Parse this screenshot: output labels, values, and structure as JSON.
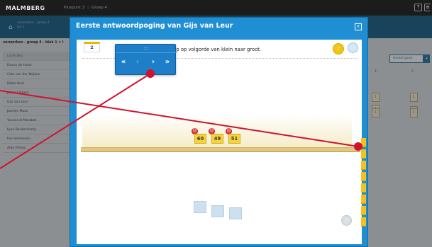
{
  "topbar": {
    "logo": "MALMBERG",
    "crumb_1": "Pluspunt 3",
    "crumb_2": "Groep 4",
    "help_icon": "?"
  },
  "background": {
    "header_title_1": "verwerken - groep 4",
    "header_title_2": "les 1",
    "filter_label": "verwerken - groep 4 - blok 1 > l",
    "students_header": "LEERLING",
    "students": [
      "Davey de Haan",
      "Cato van der Keijzen",
      "Robin Knol",
      "Justin Lamers",
      "Gijs van Leur",
      "Jasmijn Maas",
      "Younes el Morabet",
      "Lynn Beukenkamp",
      "Ilse Verhoeven",
      "Aida Yilmaz"
    ],
    "sort_button": "Aantal goed",
    "col_4": "4",
    "col_5": "5"
  },
  "modal": {
    "title": "Eerste antwoordpoging van Gijs van Leur",
    "close_icon": "close-icon",
    "page_number": "2",
    "instruction": "eep op volgorde van klein naar groot.",
    "toolbar": {
      "grip": ":::",
      "first": "«",
      "prev": "‹",
      "next": "›",
      "last": "»"
    },
    "cards": [
      "60",
      "49",
      "51"
    ],
    "feedback_icon": "sad-face-icon"
  },
  "colors": {
    "header": "#1f8ed3",
    "card": "#f6d33d",
    "error": "#e23a3a",
    "annotation": "#d0122c"
  }
}
